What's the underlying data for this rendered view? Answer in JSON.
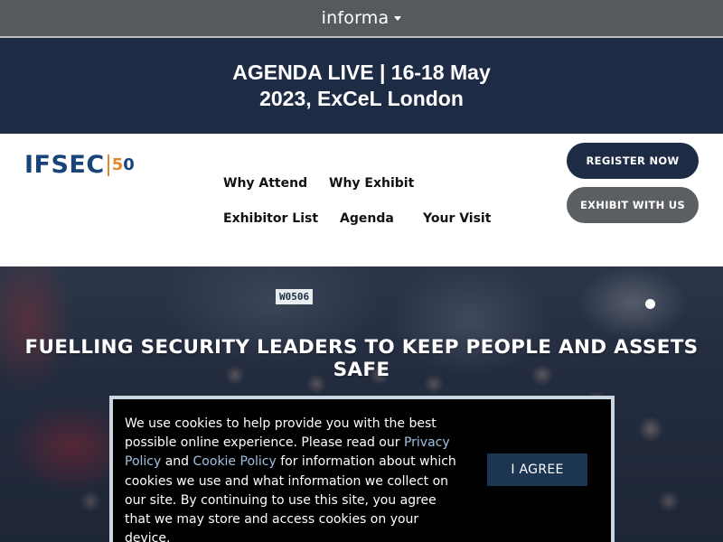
{
  "topbar": {
    "brand": "informa"
  },
  "banner": {
    "text": "AGENDA LIVE | 16-18 May 2023, ExCeL London"
  },
  "logo": {
    "word": "IFSEC",
    "five": "5",
    "zero": "0"
  },
  "nav": {
    "links": [
      {
        "label": "Why Attend"
      },
      {
        "label": "Why Exhibit"
      },
      {
        "label": "Exhibitor List"
      },
      {
        "label": "Agenda"
      },
      {
        "label": "Your Visit"
      }
    ],
    "register_label": "REGISTER NOW",
    "exhibit_label": "EXHIBIT WITH US"
  },
  "hero": {
    "headline": "FUELLING SECURITY LEADERS TO KEEP PEOPLE AND ASSETS SAFE",
    "sign": "W0506"
  },
  "cookie": {
    "text_1": "We use cookies to help provide you with the best possible online experience. Please read our ",
    "privacy_link": "Privacy Policy",
    "text_2": " and ",
    "cookie_link": "Cookie Policy",
    "text_3": " for information about which cookies we use and what information we collect on our site. By continuing to use this site, you agree that we may store and access cookies on your device.",
    "agree_label": "I AGREE"
  },
  "colors": {
    "navy": "#1d2b45",
    "grey_bar": "#555a5e",
    "exhibit_button": "#5c5f62",
    "logo_blue": "#19447a",
    "logo_orange": "#e08a2b",
    "agree_button": "#1c3652"
  },
  "icons": {
    "brand_caret": "caret-down-icon",
    "carousel": "carousel-dot-icon"
  }
}
